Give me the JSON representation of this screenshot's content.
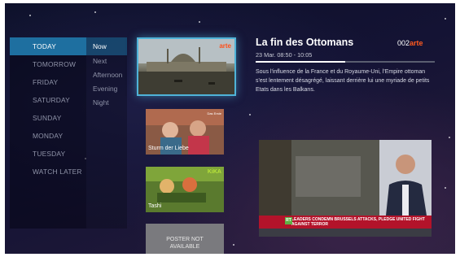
{
  "days": [
    "TODAY",
    "TOMORROW",
    "FRIDAY",
    "SATURDAY",
    "SUNDAY",
    "MONDAY",
    "TUESDAY",
    "WATCH LATER"
  ],
  "selected_day": "TODAY",
  "times": [
    "Now",
    "Next",
    "Afternoon",
    "Evening",
    "Night"
  ],
  "selected_time": "Now",
  "cards": {
    "selected": {
      "badge": "arte"
    },
    "sturm": {
      "title": "Sturm der Liebe",
      "badge": "Das Erste"
    },
    "tashi": {
      "title": "Tashi",
      "badge": "KiKA"
    },
    "poster": {
      "text": "POSTER NOT AVAILABLE"
    }
  },
  "detail": {
    "title": "La fin des Ottomans",
    "channel_num": "002",
    "channel_name": "arte",
    "time": "23 Mar. 08:50 - 10:05",
    "progress_fraction": 0.5,
    "description": "Sous l'influence de la France et du Royaume-Uni, l'Empire ottoman s'est lentement désagrégé, laissant derrière lui une myriade de petits Etats dans les Balkans."
  },
  "preview": {
    "ticker": "LEADERS CONDEMN BRUSSELS ATTACKS, PLEDGE UNITED FIGHT AGAINST TERROR",
    "logo": "RT"
  }
}
